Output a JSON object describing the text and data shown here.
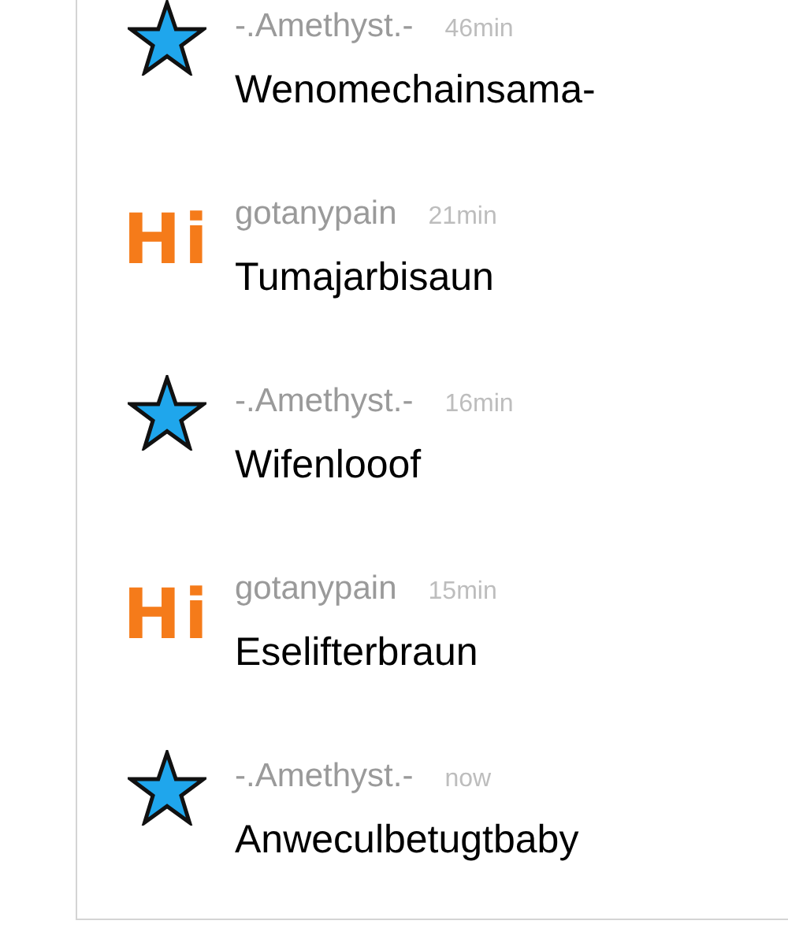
{
  "messages": [
    {
      "avatar": {
        "kind": "star"
      },
      "user": "-.Amethyst.-",
      "time": "46min",
      "text": "Wenomechainsama-"
    },
    {
      "avatar": {
        "kind": "text",
        "text": "Hi"
      },
      "user": "gotanypain",
      "time": "21min",
      "text": "Tumajarbisaun"
    },
    {
      "avatar": {
        "kind": "star"
      },
      "user": "-.Amethyst.-",
      "time": "16min",
      "text": "Wifenlooof"
    },
    {
      "avatar": {
        "kind": "text",
        "text": "Hi"
      },
      "user": "gotanypain",
      "time": "15min",
      "text": "Eselifterbraun"
    },
    {
      "avatar": {
        "kind": "star"
      },
      "user": "-.Amethyst.-",
      "time": "now",
      "text": "Anweculbetugtbaby"
    }
  ]
}
